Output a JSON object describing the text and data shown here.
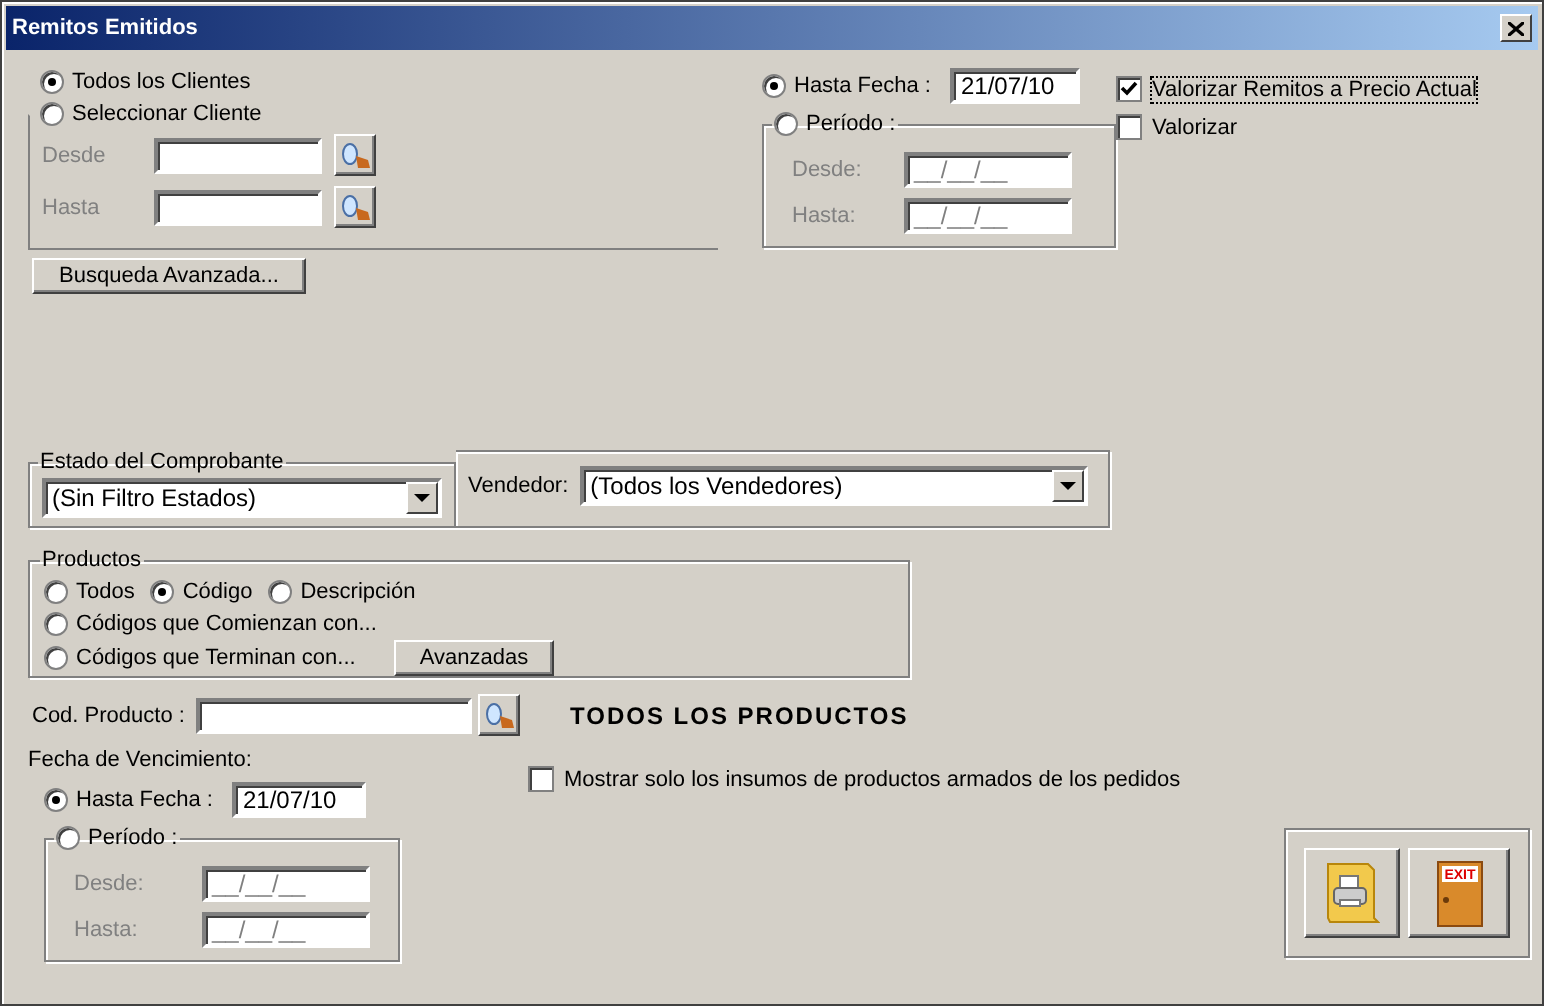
{
  "window": {
    "title": "Remitos Emitidos"
  },
  "clients": {
    "options": [
      {
        "label": "Todos los Clientes",
        "selected": true
      },
      {
        "label": "Seleccionar Cliente",
        "selected": false
      }
    ],
    "fields": [
      {
        "label": "Desde",
        "disabled": true
      },
      {
        "label": "Hasta",
        "disabled": true
      }
    ]
  },
  "advanced_search_button": "Busqueda Avanzada...",
  "date_filter": {
    "to_date": {
      "label": "Hasta Fecha :",
      "selected": true,
      "value": "21/07/10"
    },
    "period": {
      "label": "Período :",
      "selected": false
    },
    "period_fields": [
      {
        "label": "Desde:",
        "value": "__/__/__",
        "disabled": true
      },
      {
        "label": "Hasta:",
        "value": "__/__/__",
        "disabled": true
      }
    ]
  },
  "checkboxes": [
    {
      "label": "Valorizar Remitos a Precio Actual",
      "checked": true,
      "focused": true
    },
    {
      "label": "Valorizar",
      "checked": false,
      "focused": false
    }
  ],
  "estado": {
    "title": "Estado del Comprobante",
    "value": "(Sin Filtro Estados)"
  },
  "vendedor": {
    "label": "Vendedor:",
    "value": "(Todos los Vendedores)"
  },
  "productos": {
    "title": "Productos",
    "match_options": [
      {
        "label": "Todos",
        "selected": false
      },
      {
        "label": "Código",
        "selected": true
      },
      {
        "label": "Descripción",
        "selected": false
      }
    ],
    "range_options": [
      {
        "label": "Códigos que Comienzan con...",
        "selected": false
      },
      {
        "label": "Códigos que Terminan con...",
        "selected": false
      }
    ],
    "advanced_button": "Avanzadas"
  },
  "product_code": {
    "label": "Cod. Producto :",
    "status": "TODOS LOS PRODUCTOS"
  },
  "expiry": {
    "title": "Fecha de Vencimiento:",
    "to_date": {
      "label": "Hasta Fecha :",
      "selected": true,
      "value": "21/07/10"
    },
    "period": {
      "label": "Período :",
      "selected": false
    },
    "period_fields": [
      {
        "label": "Desde:",
        "value": "__/__/__",
        "disabled": true
      },
      {
        "label": "Hasta:",
        "value": "__/__/__",
        "disabled": true
      }
    ]
  },
  "show_inputs_checkbox": {
    "label": "Mostrar solo los insumos de productos armados de los pedidos",
    "checked": false
  },
  "actions": [
    {
      "kind": "print"
    },
    {
      "kind": "exit",
      "sign": "EXIT"
    }
  ]
}
